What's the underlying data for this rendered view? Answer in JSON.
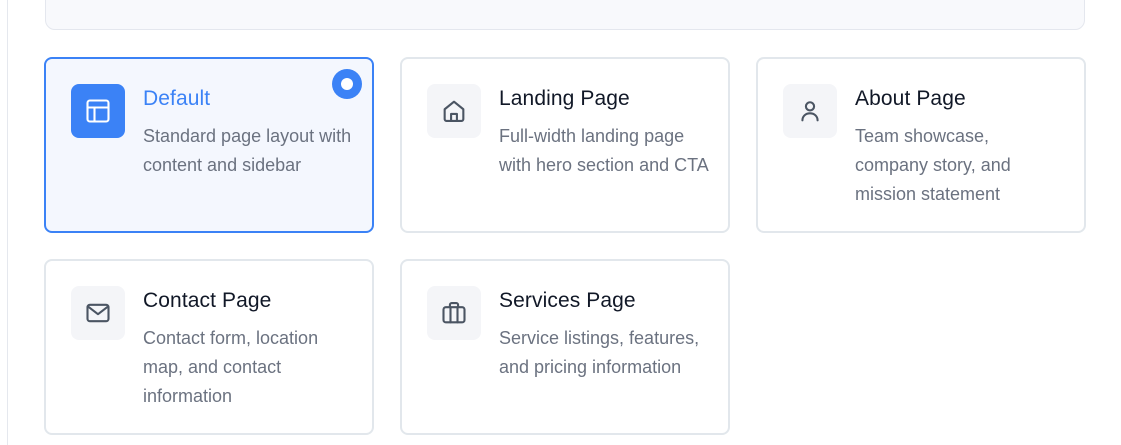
{
  "accent_color": "#3b82f6",
  "templates": [
    {
      "id": "default",
      "title": "Default",
      "description": "Standard page layout with content and sidebar",
      "icon": "layout-icon",
      "selected": true
    },
    {
      "id": "landing",
      "title": "Landing Page",
      "description": "Full-width landing page with hero section and CTA",
      "icon": "home-icon",
      "selected": false
    },
    {
      "id": "about",
      "title": "About Page",
      "description": "Team showcase, company story, and mission statement",
      "icon": "user-icon",
      "selected": false
    },
    {
      "id": "contact",
      "title": "Contact Page",
      "description": "Contact form, location map, and contact information",
      "icon": "mail-icon",
      "selected": false
    },
    {
      "id": "services",
      "title": "Services Page",
      "description": "Service listings, features, and pricing information",
      "icon": "briefcase-icon",
      "selected": false
    }
  ]
}
